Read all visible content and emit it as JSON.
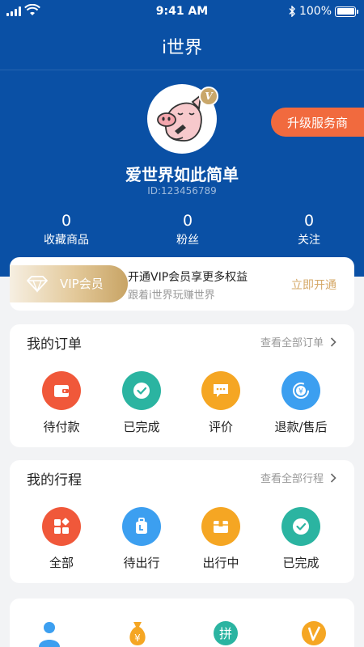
{
  "status_bar": {
    "time": "9:41 AM",
    "battery": "100%",
    "battery_level": 1.0
  },
  "header": {
    "title": "i世界",
    "upgrade_button": "升级服务商"
  },
  "profile": {
    "name": "爱世界如此简单",
    "id": "ID:123456789",
    "vip_badge": "V"
  },
  "stats": [
    {
      "value": "0",
      "label": "收藏商品"
    },
    {
      "value": "0",
      "label": "粉丝"
    },
    {
      "value": "0",
      "label": "关注"
    }
  ],
  "vip_banner": {
    "pill_label": "VIP会员",
    "title": "开通VIP会员享更多权益",
    "subtitle": "跟着i世界玩赚世界",
    "action": "立即开通"
  },
  "orders": {
    "title": "我的订单",
    "more": "查看全部订单",
    "items": [
      {
        "label": "待付款",
        "icon": "wallet-icon",
        "color": "#f0583a"
      },
      {
        "label": "已完成",
        "icon": "check-circle-icon",
        "color": "#2bb4a1"
      },
      {
        "label": "评价",
        "icon": "comment-icon",
        "color": "#f5a623"
      },
      {
        "label": "退款/售后",
        "icon": "refund-icon",
        "color": "#3c9ff0"
      }
    ]
  },
  "trips": {
    "title": "我的行程",
    "more": "查看全部行程",
    "items": [
      {
        "label": "全部",
        "icon": "grid-icon",
        "color": "#f0583a"
      },
      {
        "label": "待出行",
        "icon": "luggage-icon",
        "color": "#3c9ff0"
      },
      {
        "label": "出行中",
        "icon": "package-icon",
        "color": "#f5a623"
      },
      {
        "label": "已完成",
        "icon": "check-circle-icon",
        "color": "#2bb4a1"
      }
    ]
  },
  "bottom_icons": [
    {
      "icon": "user-icon",
      "color": "#3c9ff0"
    },
    {
      "icon": "money-bag-icon",
      "color": "#f5a623"
    },
    {
      "icon": "group-buy-icon",
      "color": "#2bb4a1",
      "text": "拼"
    },
    {
      "icon": "v-coin-icon",
      "color": "#f5a623"
    }
  ]
}
